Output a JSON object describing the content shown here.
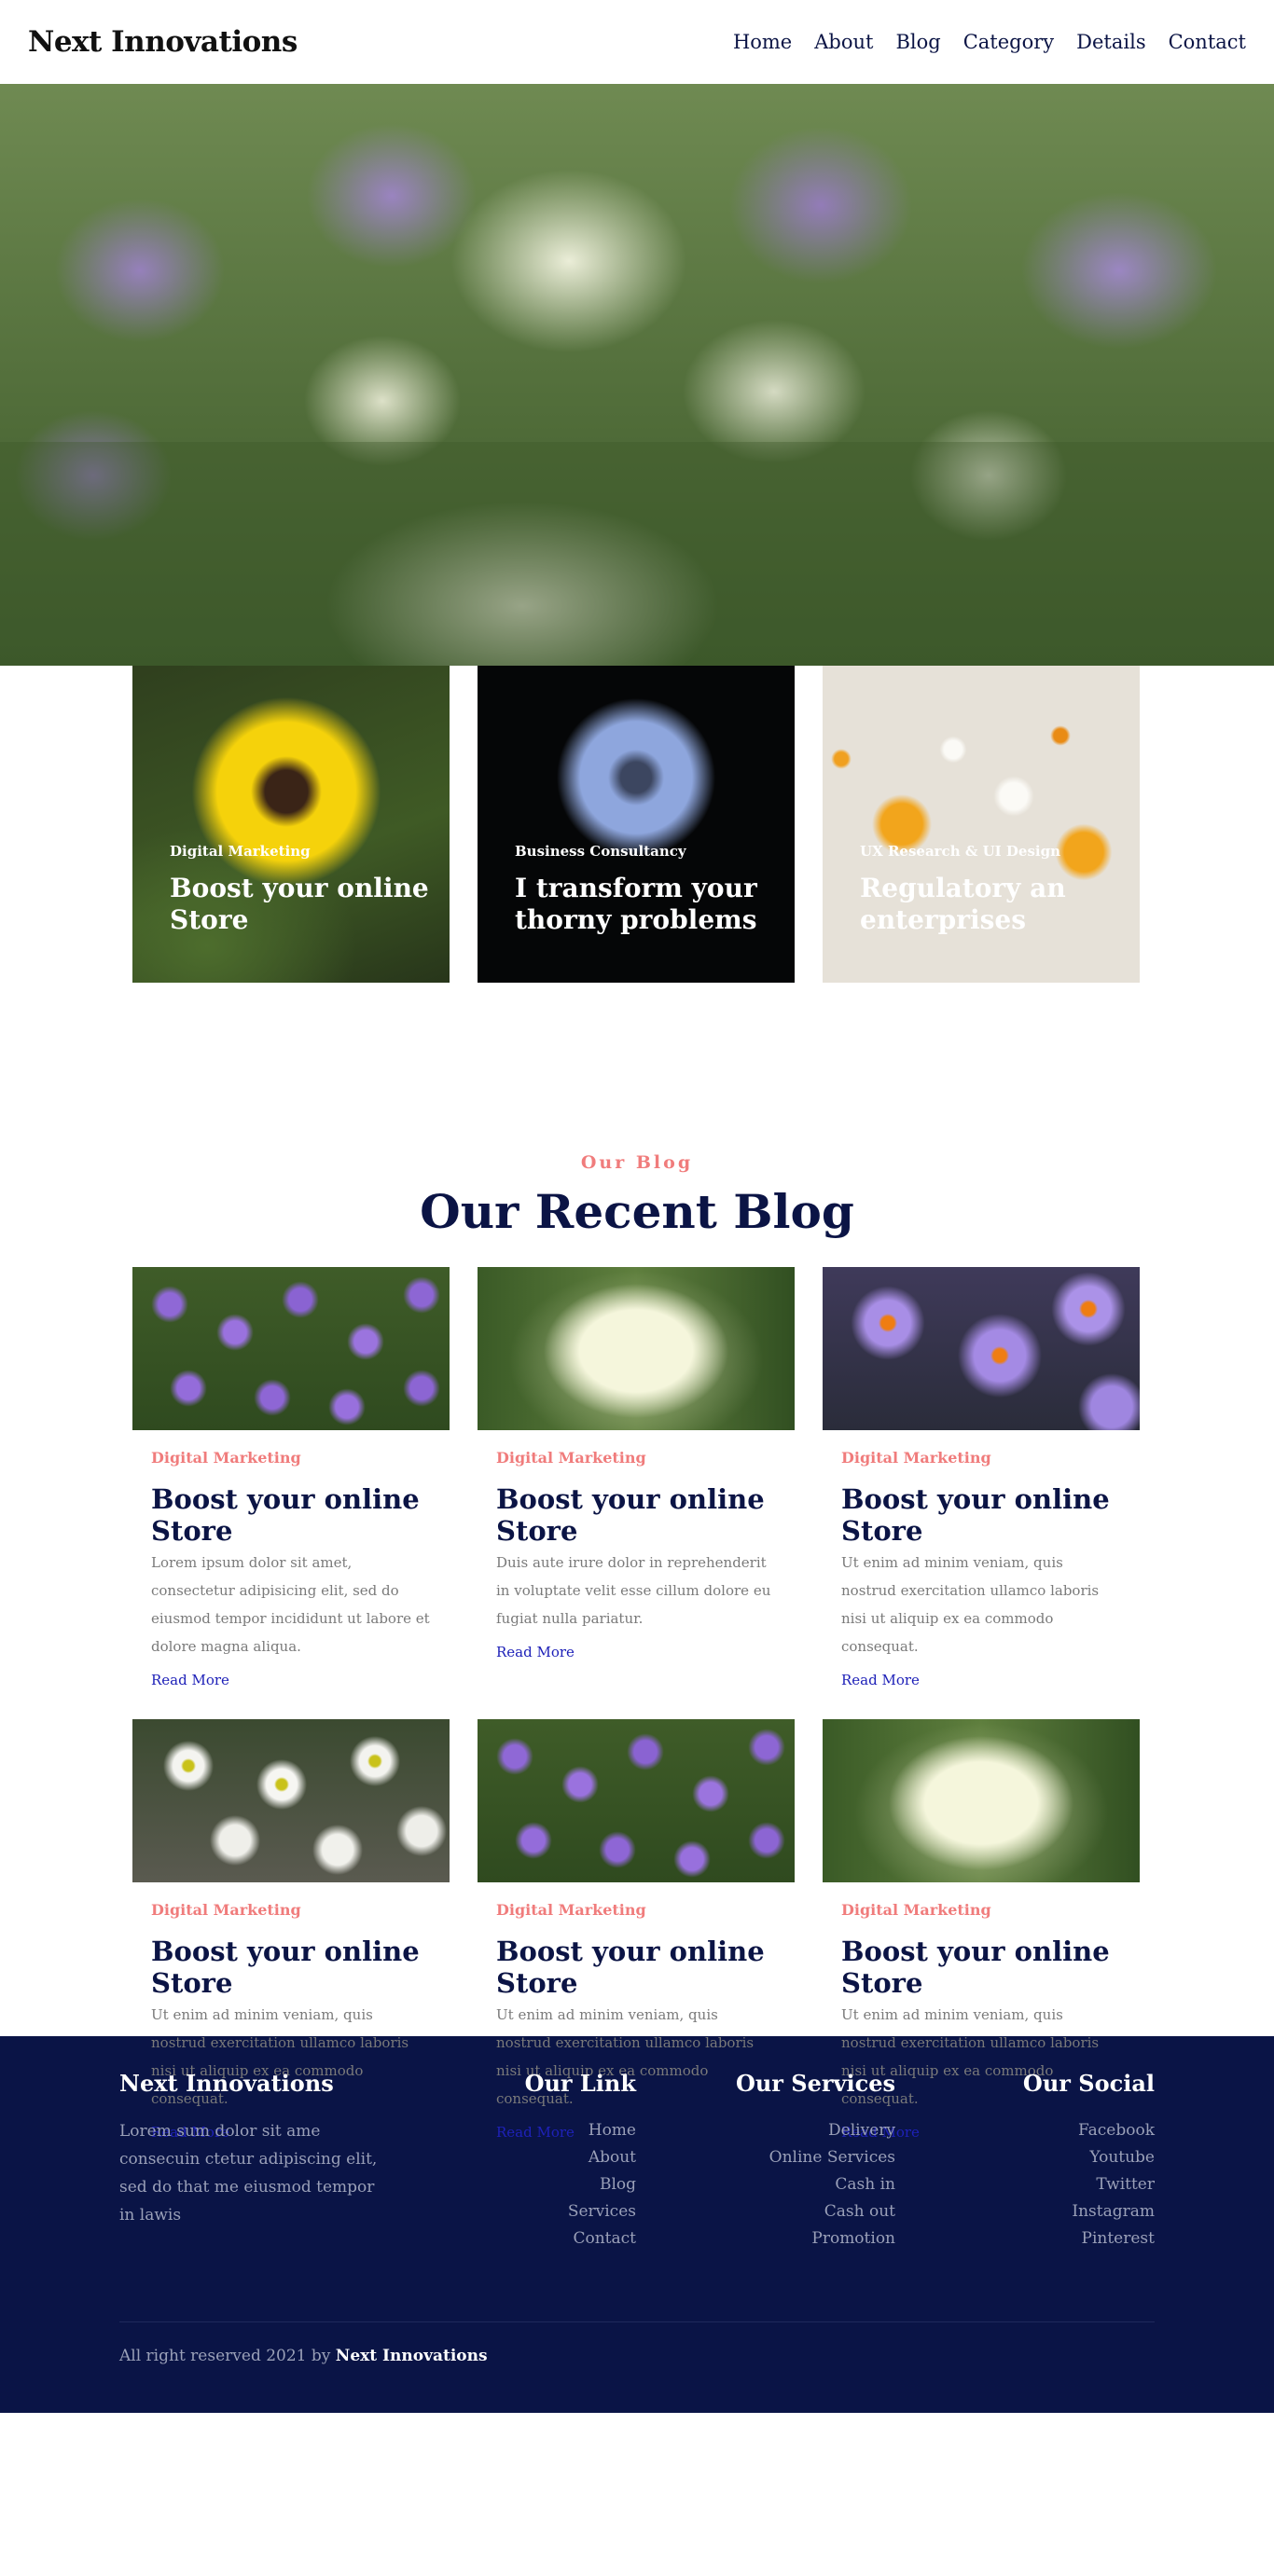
{
  "header": {
    "brand": "Next Innovations",
    "nav": [
      "Home",
      "About",
      "Blog",
      "Category",
      "Details",
      "Contact"
    ]
  },
  "features": [
    {
      "category": "Digital Marketing",
      "title": "Boost your online Store"
    },
    {
      "category": "Business Consultancy",
      "title": "I transform your thorny problems"
    },
    {
      "category": "UX Research & UI Design",
      "title": "Regulatory an enterprises"
    }
  ],
  "blog": {
    "eyebrow": "Our Blog",
    "heading": "Our Recent Blog",
    "posts": [
      {
        "category": "Digital Marketing",
        "title": "Boost your online Store",
        "excerpt": "Lorem ipsum dolor sit amet, consectetur adipisicing elit, sed do eiusmod tempor incididunt ut labore et dolore magna aliqua.",
        "link": "Read More",
        "image": "purple-pansies"
      },
      {
        "category": "Digital Marketing",
        "title": "Boost your online Store",
        "excerpt": "Duis aute irure dolor in reprehenderit in voluptate velit esse cillum dolore eu fugiat nulla pariatur.",
        "link": "Read More",
        "image": "white-rose"
      },
      {
        "category": "Digital Marketing",
        "title": "Boost your online Store",
        "excerpt": "Ut enim ad minim veniam, quis nostrud exercitation ullamco laboris nisi ut aliquip ex ea commodo consequat.",
        "link": "Read More",
        "image": "purple-asters"
      },
      {
        "category": "Digital Marketing",
        "title": "Boost your online Store",
        "excerpt": "Ut enim ad minim veniam, quis nostrud exercitation ullamco laboris nisi ut aliquip ex ea commodo consequat.",
        "link": "Read More",
        "image": "white-daisies"
      },
      {
        "category": "Digital Marketing",
        "title": "Boost your online Store",
        "excerpt": "Ut enim ad minim veniam, quis nostrud exercitation ullamco laboris nisi ut aliquip ex ea commodo consequat.",
        "link": "Read More",
        "image": "purple-pansies"
      },
      {
        "category": "Digital Marketing",
        "title": "Boost your online Store",
        "excerpt": "Ut enim ad minim veniam, quis nostrud exercitation ullamco laboris nisi ut aliquip ex ea commodo consequat.",
        "link": "Read More",
        "image": "white-rose"
      }
    ]
  },
  "footer": {
    "brand": "Next Innovations",
    "about": "Lorem sum dolor sit ame consecuin ctetur adipiscing elit, sed do that me eiusmod tempor in lawis",
    "columns": [
      {
        "title": "Our Link",
        "items": [
          "Home",
          "About",
          "Blog",
          "Services",
          "Contact"
        ]
      },
      {
        "title": "Our Services",
        "items": [
          "Delivery",
          "Online Services",
          "Cash in",
          "Cash out",
          "Promotion"
        ]
      },
      {
        "title": "Our Social",
        "items": [
          "Facebook",
          "Youtube",
          "Twitter",
          "Instagram",
          "Pinterest"
        ]
      }
    ],
    "copyright_prefix": "All right reserved 2021 by",
    "copyright_brand": "Next Innovations"
  },
  "colors": {
    "navy": "#0b1445",
    "footer_bg": "#0a1446",
    "accent_coral": "#f07c7c",
    "link_blue": "#1e21b8"
  }
}
